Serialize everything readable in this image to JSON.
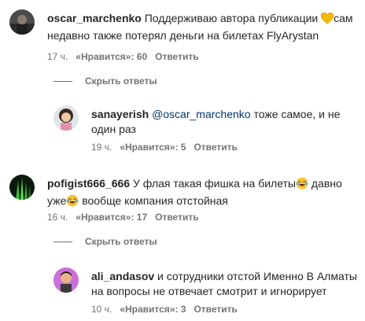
{
  "comments": [
    {
      "username": "oscar_marchenko",
      "text_1": "Поддерживаю автора публикации ",
      "emoji_1": "yellow-heart-icon",
      "text_2": "сам недавно также потерял деньги на билетах FlyArystan",
      "time": "17 ч.",
      "likes": "«Нравится»: 60",
      "reply": "Ответить"
    },
    {
      "username": "sanayerish",
      "mention": "@oscar_marchenko",
      "text": " тоже самое, и не один раз",
      "time": "19 ч.",
      "likes": "«Нравится»: 5",
      "reply": "Ответить"
    },
    {
      "username": "pofigist666_666",
      "text_1": "У флая такая фишка на билеты",
      "text_2": " давно уже",
      "text_3": " вообще компания отстойная",
      "emoji": "tears-of-joy-icon",
      "time": "16 ч.",
      "likes": "«Нравится»: 17",
      "reply": "Ответить"
    },
    {
      "username": "ali_andasov",
      "text": "и сотрудники отстой Именно В Алматы на вопросы не отвечает смотрит и игнорирует",
      "time": "10 ч.",
      "likes": "«Нравится»: 3",
      "reply": "Ответить"
    }
  ],
  "hide_replies_label": "Скрыть ответы",
  "colors": {
    "text": "#262626",
    "secondary": "#737373",
    "mention": "#00376b"
  }
}
